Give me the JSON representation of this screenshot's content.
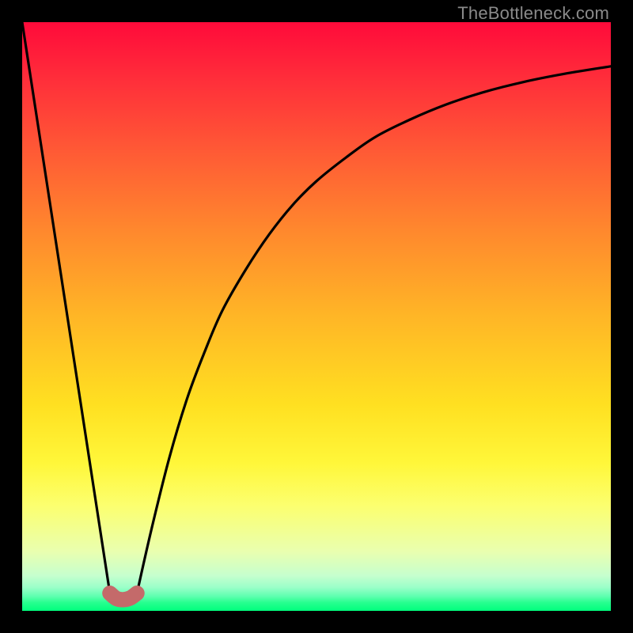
{
  "watermark": "TheBottleneck.com",
  "colors": {
    "frame": "#000000",
    "curve": "#000000",
    "marker_fill": "#c46a6a",
    "marker_stroke": "#c46a6a"
  },
  "chart_data": {
    "type": "line",
    "title": "",
    "xlabel": "",
    "ylabel": "",
    "xlim": [
      0,
      100
    ],
    "ylim": [
      0,
      100
    ],
    "series": [
      {
        "name": "left-branch",
        "x": [
          0,
          14.9
        ],
        "y": [
          100,
          3
        ]
      },
      {
        "name": "right-branch",
        "x": [
          19.5,
          22,
          25,
          28,
          31,
          34,
          38,
          42,
          46,
          50,
          55,
          60,
          66,
          72,
          78,
          85,
          92,
          100
        ],
        "y": [
          3,
          14,
          26,
          36,
          44,
          51,
          58,
          64,
          69,
          73,
          77,
          80.5,
          83.5,
          86,
          88,
          89.8,
          91.2,
          92.5
        ]
      }
    ],
    "marker": {
      "name": "optimal-range",
      "points": [
        {
          "x": 14.9,
          "y": 3.0
        },
        {
          "x": 16.0,
          "y": 2.1
        },
        {
          "x": 17.2,
          "y": 1.9
        },
        {
          "x": 18.4,
          "y": 2.2
        },
        {
          "x": 19.5,
          "y": 3.0
        }
      ],
      "stroke_width_pct": 2.6
    }
  }
}
